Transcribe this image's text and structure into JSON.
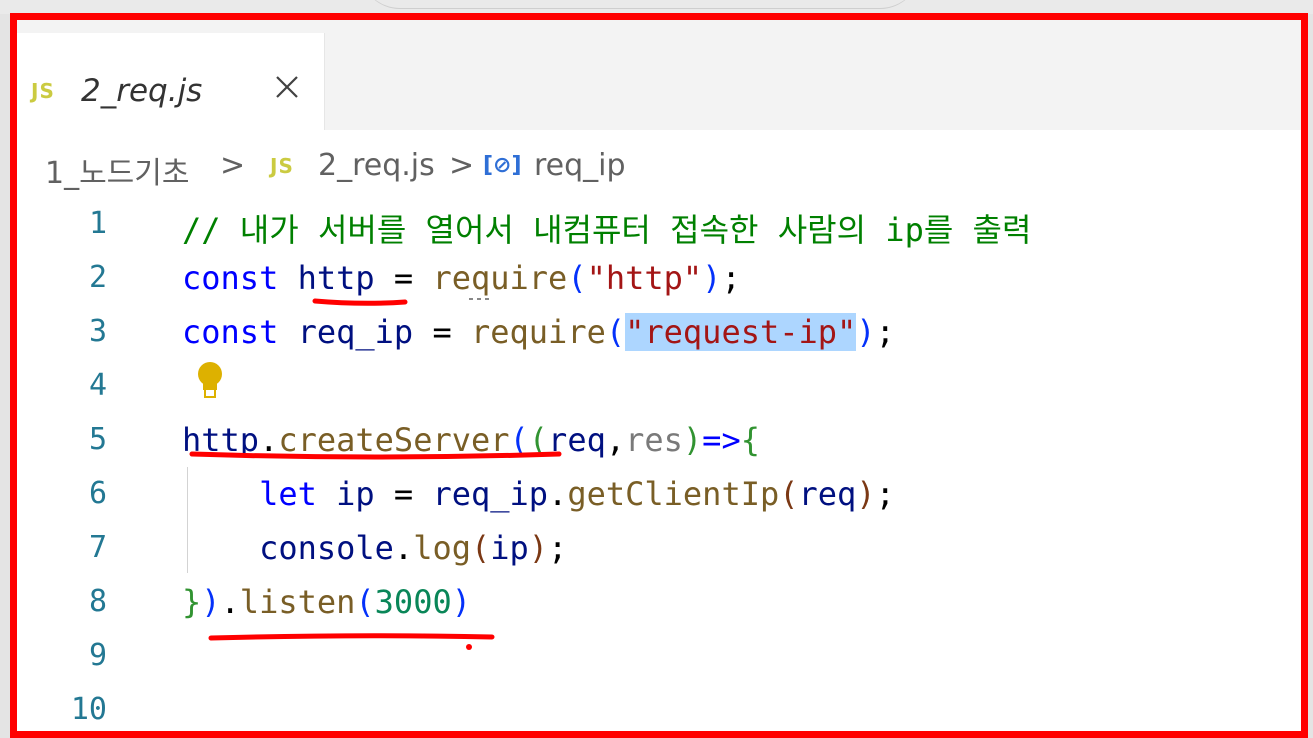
{
  "tab": {
    "icon": "JS",
    "filename": "2_req.js",
    "close_icon": "close-icon"
  },
  "breadcrumb": {
    "folder": "1_노드기초",
    "sep": ">",
    "file_icon": "JS",
    "file": "2_req.js",
    "symbol_icon": "[⊘]",
    "symbol": "req_ip"
  },
  "editor": {
    "line_numbers": [
      "1",
      "2",
      "3",
      "4",
      "5",
      "6",
      "7",
      "8",
      "9",
      "10"
    ],
    "l1": {
      "comment": "// 내가 서버를 열어서 내컴퓨터 접속한 사람의 ip를 출력"
    },
    "l2": {
      "kw": "const",
      "name": "http",
      "eq": " = ",
      "fn": "require",
      "open": "(",
      "str": "\"http\"",
      "close": ")",
      "semi": ";"
    },
    "l3": {
      "kw": "const",
      "name": "req_ip",
      "eq": " = ",
      "fn": "require",
      "open": "(",
      "str": "\"request-ip\"",
      "close": ")",
      "semi": ";"
    },
    "l5": {
      "obj": "http",
      "dot": ".",
      "fn": "createServer",
      "open1": "(",
      "open2": "(",
      "p1": "req",
      "comma": ",",
      "p2": "res",
      "close2": ")",
      "arrow": "=>",
      "brace": "{"
    },
    "l6": {
      "kw": "let",
      "name": "ip",
      "eq": " = ",
      "obj": "req_ip",
      "dot": ".",
      "fn": "getClientIp",
      "open": "(",
      "arg": "req",
      "close": ")",
      "semi": ";"
    },
    "l7": {
      "obj": "console",
      "dot": ".",
      "fn": "log",
      "open": "(",
      "arg": "ip",
      "close": ")",
      "semi": ";"
    },
    "l8": {
      "brace": "}",
      "close": ")",
      "dot": ".",
      "fn": "listen",
      "open": "(",
      "num": "3000",
      "close2": ")"
    }
  },
  "colors": {
    "frame": "#ff0000",
    "annotation": "#ff0000",
    "comment": "#008000",
    "keyword": "#0000ff",
    "string": "#a31515"
  }
}
